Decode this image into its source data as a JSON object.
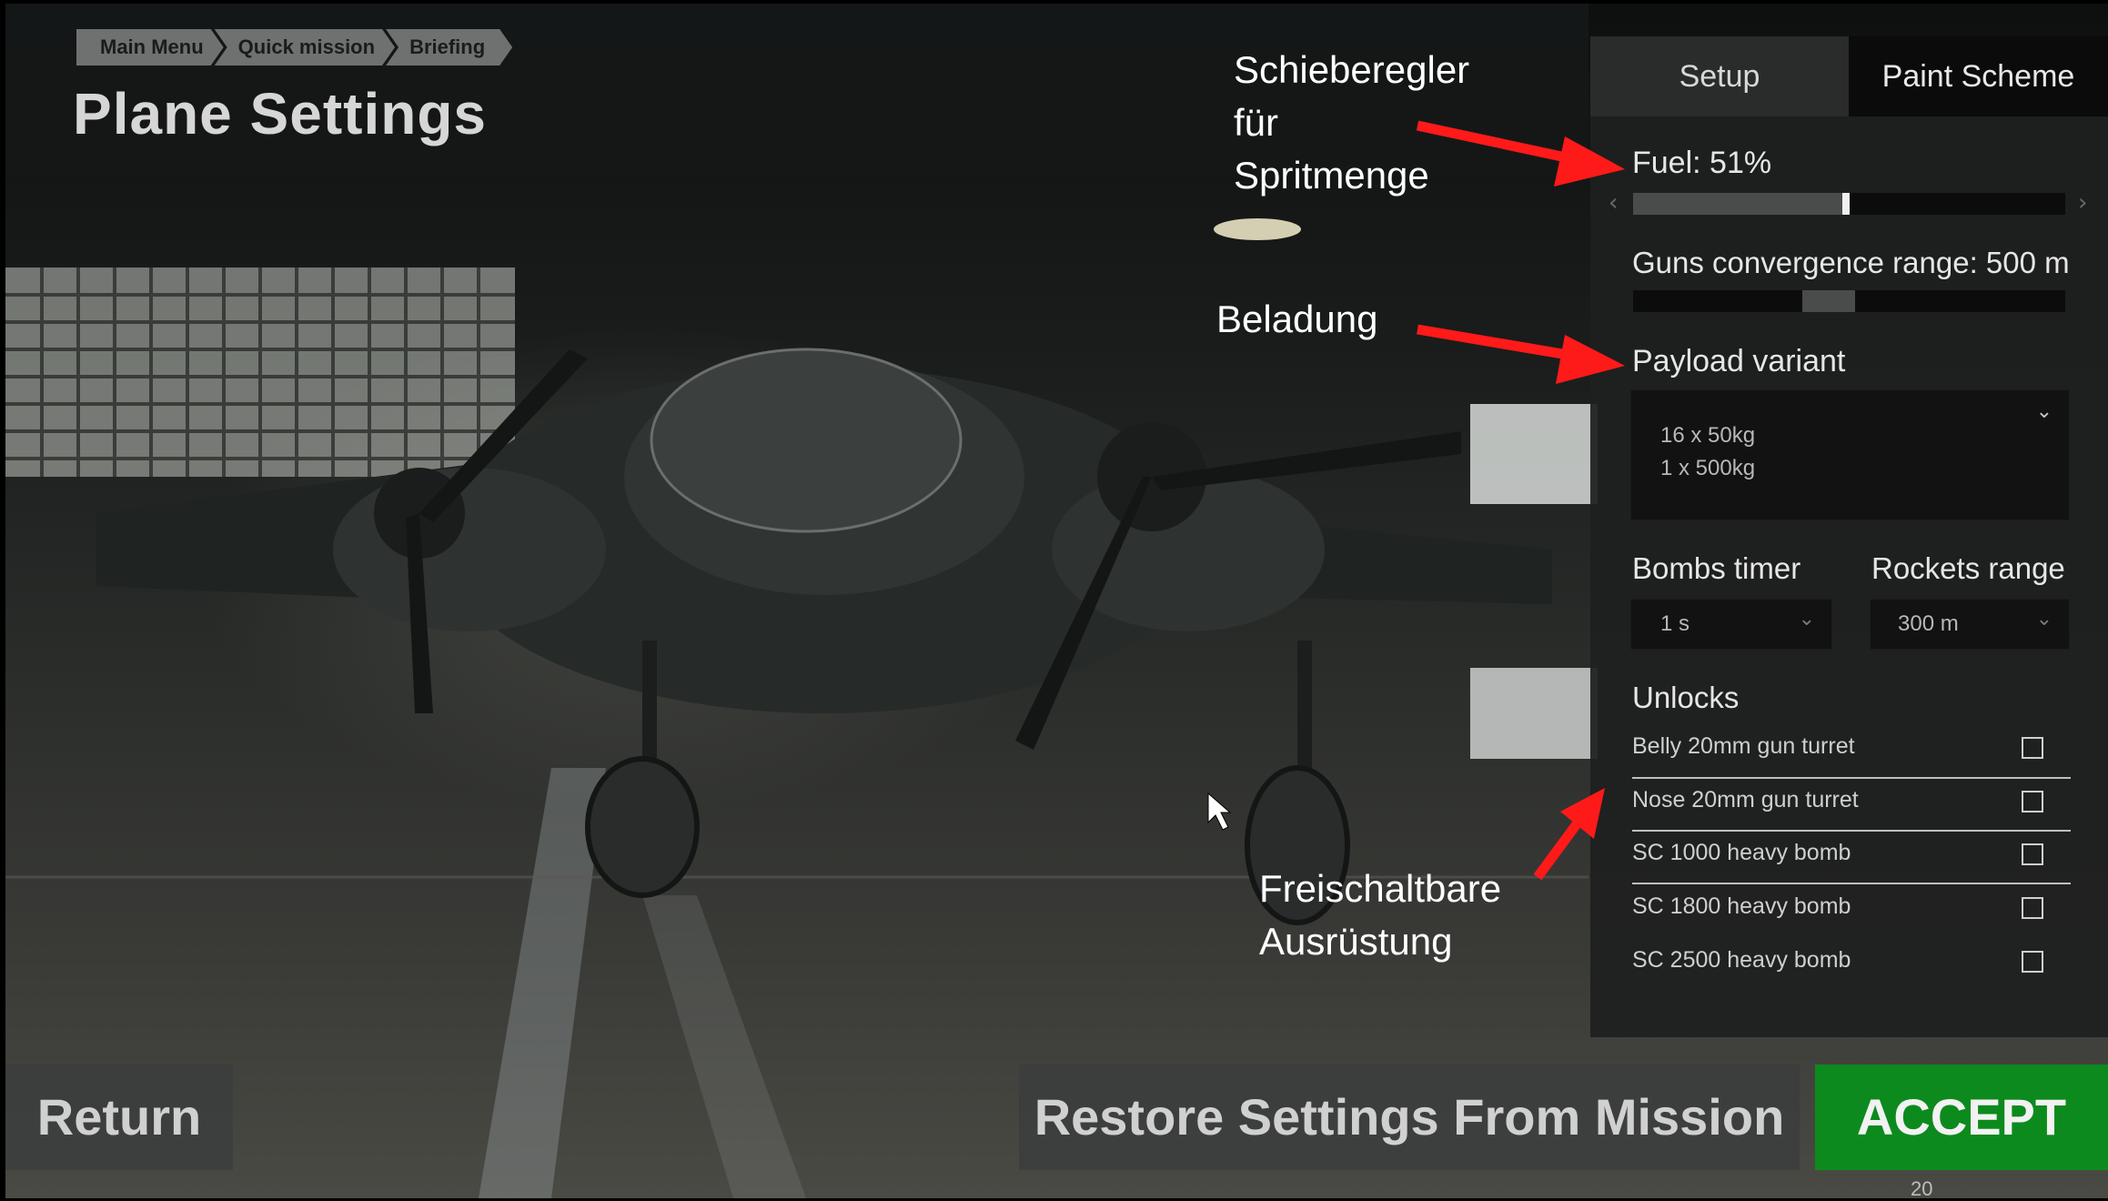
{
  "breadcrumb": [
    "Main Menu",
    "Quick mission",
    "Briefing"
  ],
  "title": "Plane Settings",
  "tabs": {
    "setup": "Setup",
    "paint": "Paint Scheme"
  },
  "fuel": {
    "label": "Fuel: 51%",
    "fraction": 0.51
  },
  "guns": {
    "label": "Guns convergence range: 500 m",
    "fraction": 0.45
  },
  "payload": {
    "label": "Payload variant",
    "line1": "16 x 50kg",
    "line2": "1 x 500kg"
  },
  "bombs_timer": {
    "label": "Bombs timer",
    "value": "1 s"
  },
  "rockets_range": {
    "label": "Rockets range",
    "value": "300 m"
  },
  "unlocks": {
    "label": "Unlocks",
    "items": [
      "Belly 20mm gun turret",
      "Nose 20mm gun turret",
      "SC 1000 heavy bomb",
      "SC 1800 heavy bomb",
      "SC 2500 heavy bomb"
    ]
  },
  "buttons": {
    "return": "Return",
    "restore": "Restore Settings From Mission",
    "accept": "ACCEPT"
  },
  "page_number": "20",
  "annotations": {
    "slider": "Schieberegler\nfür\nSpritmenge",
    "payload": "Beladung",
    "unlocks": "Freischaltbare\nAusrüstung"
  },
  "colors": {
    "accept": "#0d8a1d",
    "arrow": "#ff1a1a"
  }
}
